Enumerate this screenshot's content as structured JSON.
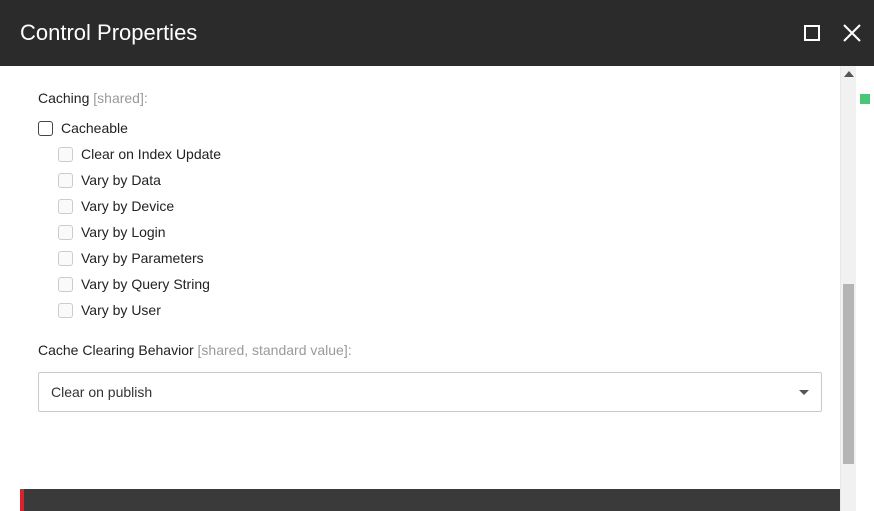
{
  "header": {
    "title": "Control Properties"
  },
  "caching": {
    "label": "Caching",
    "meta": "[shared]:",
    "cacheable": "Cacheable",
    "options": [
      "Clear on Index Update",
      "Vary by Data",
      "Vary by Device",
      "Vary by Login",
      "Vary by Parameters",
      "Vary by Query String",
      "Vary by User"
    ]
  },
  "clearing": {
    "label": "Cache Clearing Behavior",
    "meta": "[shared, standard value]:",
    "value": "Clear on publish"
  }
}
